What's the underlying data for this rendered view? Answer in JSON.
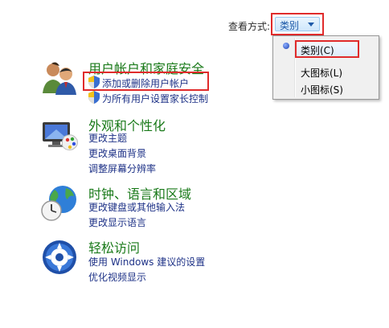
{
  "viewby": {
    "label": "查看方式:",
    "selected": "类别"
  },
  "menu": {
    "items": [
      {
        "label": "类别(C)",
        "selected": true
      },
      {
        "label": "大图标(L)",
        "selected": false
      },
      {
        "label": "小图标(S)",
        "selected": false
      }
    ]
  },
  "categories": [
    {
      "title": "用户帐户和家庭安全",
      "icon": "users-icon",
      "links": [
        "添加或删除用户帐户",
        "为所有用户设置家长控制"
      ]
    },
    {
      "title": "外观和个性化",
      "icon": "monitor-palette-icon",
      "links": [
        "更改主题",
        "更改桌面背景",
        "调整屏幕分辨率"
      ]
    },
    {
      "title": "时钟、语言和区域",
      "icon": "globe-clock-icon",
      "links": [
        "更改键盘或其他输入法",
        "更改显示语言"
      ]
    },
    {
      "title": "轻松访问",
      "icon": "ease-of-access-icon",
      "links": [
        "使用 Windows 建议的设置",
        "优化视频显示"
      ]
    }
  ],
  "colors": {
    "category_title": "#1a7a1a",
    "link": "#1e3287",
    "highlight_box": "#e02b2b"
  }
}
